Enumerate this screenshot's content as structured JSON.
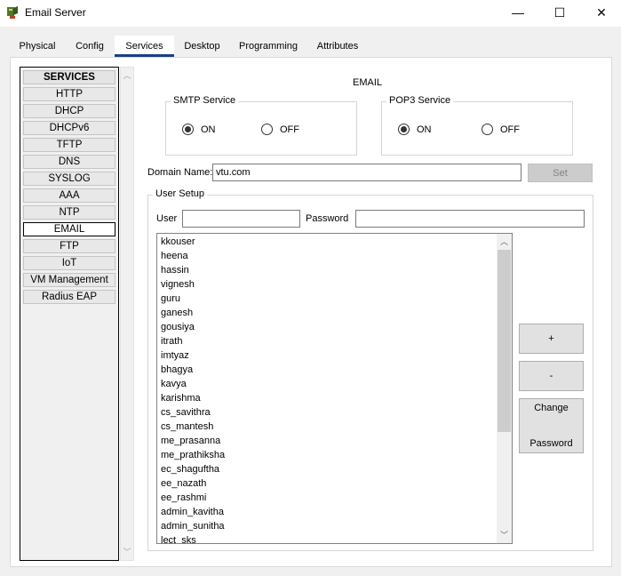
{
  "window": {
    "title": "Email Server",
    "minimize_glyph": "—",
    "maximize_glyph": "☐",
    "close_glyph": "✕",
    "app_icon": "packet-tracer-server-icon"
  },
  "tabs": [
    "Physical",
    "Config",
    "Services",
    "Desktop",
    "Programming",
    "Attributes"
  ],
  "active_tab": "Services",
  "services": {
    "header": "SERVICES",
    "items": [
      "HTTP",
      "DHCP",
      "DHCPv6",
      "TFTP",
      "DNS",
      "SYSLOG",
      "AAA",
      "NTP",
      "EMAIL",
      "FTP",
      "IoT",
      "VM Management",
      "Radius EAP"
    ],
    "selected": "EMAIL"
  },
  "email": {
    "title": "EMAIL",
    "smtp": {
      "label": "SMTP Service",
      "on_label": "ON",
      "off_label": "OFF",
      "state": "ON"
    },
    "pop3": {
      "label": "POP3 Service",
      "on_label": "ON",
      "off_label": "OFF",
      "state": "ON"
    },
    "domain": {
      "label": "Domain Name:",
      "value": "vtu.com",
      "set_label": "Set"
    },
    "user_setup": {
      "label": "User Setup",
      "user_label": "User",
      "user_value": "",
      "password_label": "Password",
      "password_value": "",
      "users": [
        "kkouser",
        "heena",
        "hassin",
        "vignesh",
        "guru",
        "ganesh",
        "gousiya",
        "itrath",
        "imtyaz",
        "bhagya",
        "kavya",
        "karishma",
        "cs_savithra",
        "cs_mantesh",
        "me_prasanna",
        "me_prathiksha",
        "ec_shaguftha",
        "ee_nazath",
        "ee_rashmi",
        "admin_kavitha",
        "admin_sunitha",
        "lect_sks"
      ],
      "add_label": "+",
      "remove_label": "-",
      "change_label_1": "Change",
      "change_label_2": "Password"
    }
  },
  "colors": {
    "active_tab_underline": "#1a3f8a",
    "panel_bg": "#ffffff",
    "window_bg": "#f0f0f0"
  }
}
